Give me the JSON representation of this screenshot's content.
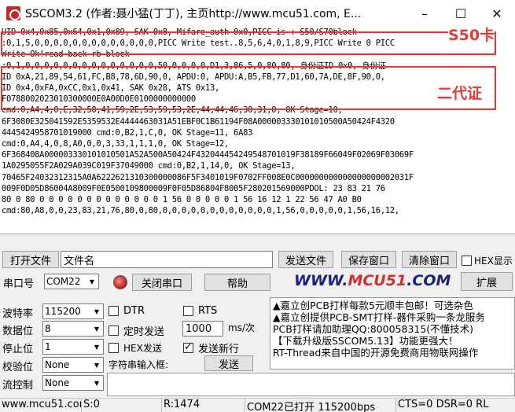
{
  "window": {
    "title": "SSCOM3.2 (作者:聂小猛(丁丁), 主页http://www.mcu51.com,  E..."
  },
  "receive": {
    "lines": [
      "UID 0x4,0x85,0x64,0x1,0x89,  SAK 0x8,  Mifare_auth 0x0,PICC is : S50/S70block",
      ":0,1,5,0,0,0,0,0,0,0,0,0,0,0,0,0,PICC Write test..8,5,6,4,0,1,8,9,PICC Write 0 PICC",
      "Write Ok!read back  rb block",
      ":0,1,0,0,0,0,0,0,0,0,0,0,0,0,0,0,50,0,0,0,0,D1,3,86,5,0,80,80,  身份证ID 0x0, 身份证",
      "ID 0xA,21,89,54,61,FC,B8,78,6D,90,0,  APDU:0,  APDU:A,B5,FB,77,D1,60,7A,DE,8F,90,0,",
      "ID 0x4,0xFA,0xCC,0x1,0x41,  SAK 0x28,  ATS 0x13,",
      "F0788002023010300000E0A00D0E0100000000000",
      "cmd:0,A4,4,0,E,32,50,41,59,2E,53,59,53,2E,44,44,46,30,31,0,      OK Stage=10,",
      "6F3080E325041592E5359532E4444463031A51EBF0C1B61194F08A000003330101010500A50424F4320",
      "4445424958701019000 cmd:0,B2,1,C,0,      OK Stage=11,    6A83",
      "cmd:0,A4,4,0,8,A0,0,0,3,33,1,1,1,0,      OK Stage=12,",
      "6F368408A000003330101010501A52A500A50424F432044454249548701019F38189F66049F02069F03069F",
      "1A0295055F2A029A039C019F37049000 cmd:0,B2,1,14,0,      OK Stage=13,",
      "70465F24032312315A0A6222621310300000086F5F3401019F0702FF008E0C000000000000000000002031F",
      "009F0D05D86004A8009F0E0500109800009F0F05D86804F8005F280201569000PDOL:   23 83 21 76",
      "80 0 80 0 0 0 0 0 0 0 0 0 0 0 0 0 1 56 0 0 0 0 0 1 56 16 12 1 22 56 47 A0 B0",
      "cmd:80,A8,0,0,23,83,21,76,80,0,80,0,0,0,0,0,0,0,0,0,0,0,0,1,56,0,0,0,0,0,1,56,16,12,"
    ],
    "label_s50": "S50卡",
    "label_idcard": "二代证"
  },
  "toolbar1": {
    "open_file": "打开文件",
    "file_name_value": "文件名",
    "send_file": "发送文件",
    "save_window": "保存窗口",
    "clear_window": "清除窗口",
    "hex_display": "HEX显示"
  },
  "toolbar2": {
    "port_label": "串口号",
    "port_value": "COM22",
    "close_port": "关闭串口",
    "help": "帮助",
    "brand_left": "WWW.",
    "brand_mid": "MCU51",
    "brand_right": ".COM",
    "expand": "扩展"
  },
  "settings": {
    "baud_label": "波特率",
    "baud_value": "115200",
    "data_label": "数据位",
    "data_value": "8",
    "stop_label": "停止位",
    "stop_value": "1",
    "parity_label": "校验位",
    "parity_value": "None",
    "flow_label": "流控制",
    "flow_value": "None"
  },
  "options": {
    "dtr": "DTR",
    "rts": "RTS",
    "timed_send": "定时发送",
    "interval_value": "1000",
    "interval_unit": "ms/次",
    "hex_send": "HEX发送",
    "send_newline": "发送新行",
    "input_label": "字符串输入框:",
    "send": "发送"
  },
  "ads": {
    "lines": [
      "▲嘉立创PCB打样每款5元顺丰包邮！可选杂色",
      "▲嘉立创提供PCB-SMT打样-器件采购一条龙服务",
      "PCB打样请加助理QQ:800058315(不懂技术)",
      "【下载升级版SSCOM5.13】功能更强大！",
      "RT-Thread来自中国的开源免费商用物联网操作"
    ]
  },
  "statusbar": {
    "site": "www.mcu51.cor",
    "sent": "S:0",
    "received": "R:1474",
    "port_state": "COM22已打开  115200bps",
    "signals": "CTS=0 DSR=0 RL"
  },
  "colors": {
    "annotation_red": "#e53935",
    "brand_blue": "#1a237e",
    "brand_red": "#d32f2f"
  }
}
